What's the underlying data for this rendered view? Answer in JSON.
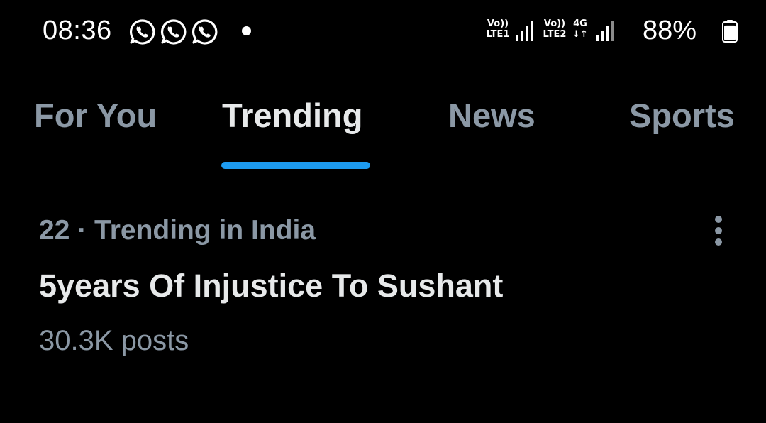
{
  "status_bar": {
    "time": "08:36",
    "notification_icons": [
      "whatsapp-icon",
      "whatsapp-icon",
      "whatsapp-icon"
    ],
    "sim1": {
      "volte": "Vo))",
      "network": "LTE1"
    },
    "sim2": {
      "volte": "Vo))",
      "network": "LTE2",
      "data_type": "4G",
      "data_arrows": "↓↑"
    },
    "battery_text": "88%",
    "battery_level": 0.88
  },
  "tabs": [
    {
      "label": "For You",
      "active": false
    },
    {
      "label": "Trending",
      "active": true
    },
    {
      "label": "News",
      "active": false
    },
    {
      "label": "Sports",
      "active": false
    }
  ],
  "trend": {
    "context": "22 · Trending in India",
    "title": "5years Of Injustice To Sushant",
    "posts": "30.3K posts"
  },
  "colors": {
    "background": "#000000",
    "primary_text": "#e7e9ea",
    "secondary_text": "#8b98a5",
    "accent": "#1d9bf0",
    "divider": "#2f3336"
  }
}
